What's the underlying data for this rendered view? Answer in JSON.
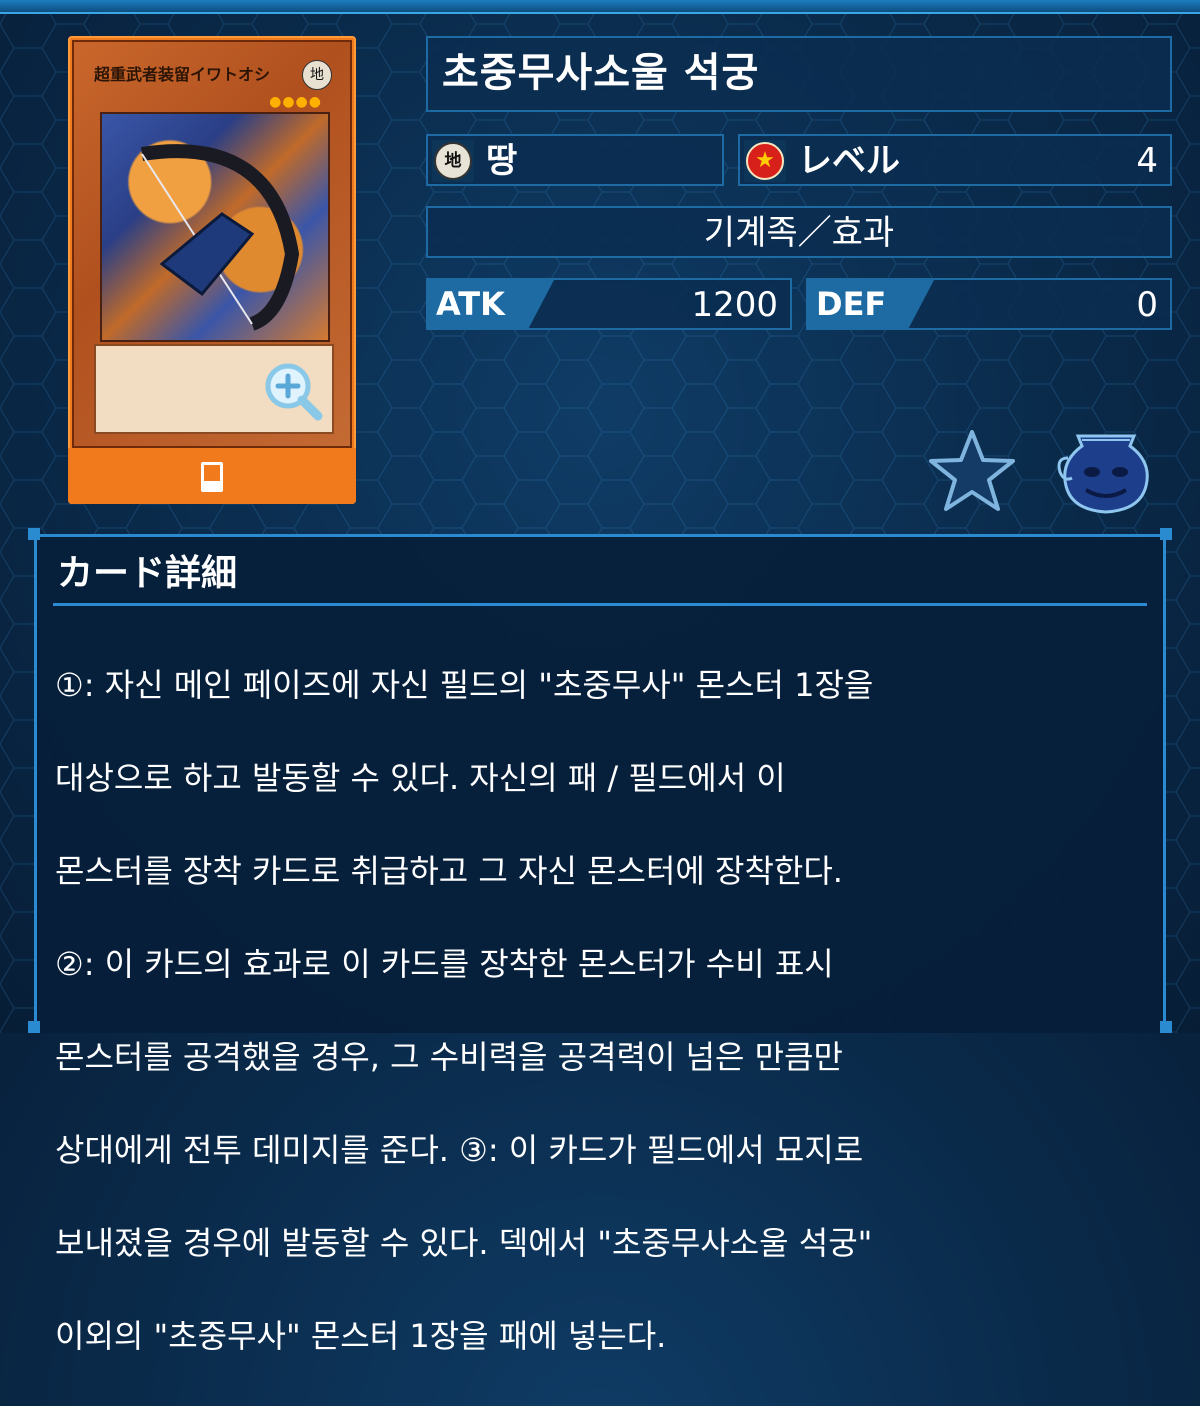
{
  "card_art": {
    "name": "超重武者装留イワトオシ",
    "attribute_glyph": "地",
    "level_stars": "●●●●"
  },
  "card": {
    "name": "초중무사소울 석궁",
    "attribute": {
      "icon": "earth-attribute-icon",
      "glyph": "地",
      "label": "땅"
    },
    "level": {
      "icon": "level-star-icon",
      "label": "レベル",
      "value": "4"
    },
    "type_line": "기계족／효과",
    "atk": {
      "label": "ATK",
      "value": "1200"
    },
    "def": {
      "label": "DEF",
      "value": "0"
    }
  },
  "detail": {
    "title": "カード詳細",
    "lines": [
      "①: 자신 메인 페이즈에 자신 필드의 \"초중무사\" 몬스터 1장을",
      "대상으로 하고 발동할 수 있다. 자신의 패 / 필드에서 이",
      "몬스터를 장착 카드로 취급하고 그 자신 몬스터에 장착한다.",
      "②: 이 카드의 효과로 이 카드를 장착한 몬스터가 수비 표시",
      "몬스터를 공격했을 경우, 그 수비력을 공격력이 넘은 만큼만",
      "상대에게 전투 데미지를 준다. ③: 이 카드가 필드에서 묘지로",
      "보내졌을 경우에 발동할 수 있다. 덱에서 \"초중무사소울 석궁\"",
      "이외의 \"초중무사\" 몬스터 1장을 패에 넣는다."
    ]
  },
  "colors": {
    "accent": "#2a8bd0",
    "card_frame": "#f07a1c",
    "panel_bg": "#0a2d50"
  }
}
